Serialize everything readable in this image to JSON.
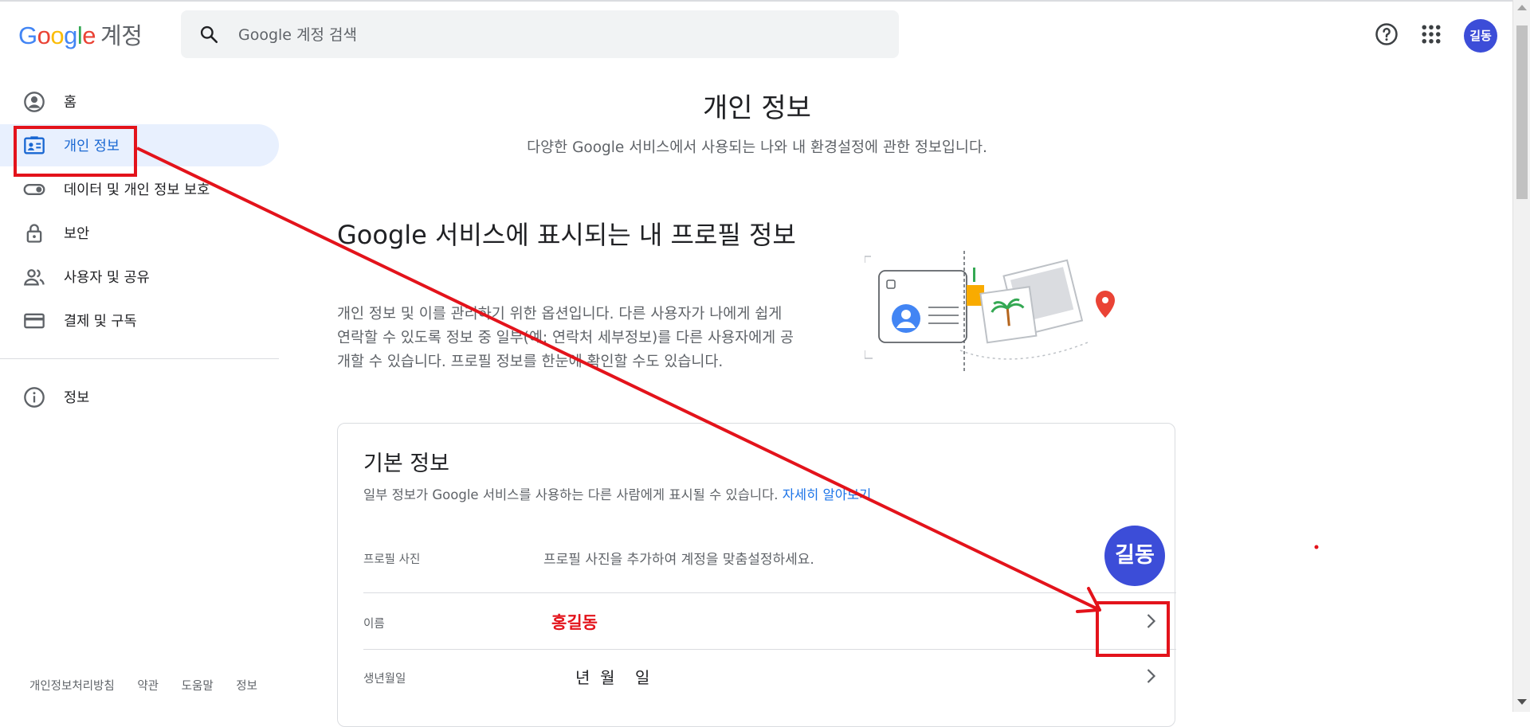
{
  "header": {
    "logo_letters": [
      "G",
      "o",
      "o",
      "g",
      "l",
      "e"
    ],
    "product": "계정",
    "search_placeholder": "Google 계정 검색",
    "avatar_text": "길동",
    "icons": [
      "help-icon",
      "apps-grid-icon"
    ]
  },
  "sidebar": {
    "items": [
      {
        "label": "홈",
        "icon": "account-circle-icon"
      },
      {
        "label": "개인 정보",
        "icon": "contact-card-icon",
        "active": true
      },
      {
        "label": "데이터 및 개인 정보 보호",
        "icon": "toggle-icon"
      },
      {
        "label": "보안",
        "icon": "lock-icon"
      },
      {
        "label": "사용자 및 공유",
        "icon": "people-icon"
      },
      {
        "label": "결제 및 구독",
        "icon": "credit-card-icon"
      }
    ],
    "info_item": {
      "label": "정보",
      "icon": "info-icon"
    },
    "footer_links": [
      "개인정보처리방침",
      "약관",
      "도움말",
      "정보"
    ]
  },
  "main": {
    "title": "개인 정보",
    "subtitle": "다양한 Google 서비스에서 사용되는 나와 내 환경설정에 관한 정보입니다.",
    "profile_heading": "Google 서비스에 표시되는 내 프로필 정보",
    "profile_description": "개인 정보 및 이를 관리하기 위한 옵션입니다. 다른 사용자가 나에게 쉽게 연락할 수 있도록 정보 중 일부(예: 연락처 세부정보)를 다른 사용자에게 공개할 수 있습니다. 프로필 정보를 한눈에 확인할 수도 있습니다.",
    "card": {
      "title": "기본 정보",
      "subtitle": "일부 정보가 Google 서비스를 사용하는 다른 사람에게 표시될 수 있습니다.",
      "learn_more": "자세히 알아보기",
      "rows": [
        {
          "label": "프로필 사진",
          "value": "프로필 사진을 추가하여 계정을 맞춤설정하세요.",
          "avatar_text": "길동"
        },
        {
          "label": "이름",
          "value": "홍길동"
        },
        {
          "label": "생년월일",
          "value": "년  월    일"
        }
      ]
    }
  },
  "colors": {
    "accent": "#1a73e8",
    "active_bg": "#e8f0fe",
    "annotation": "#e3131b",
    "avatar": "#3c4dd8"
  }
}
